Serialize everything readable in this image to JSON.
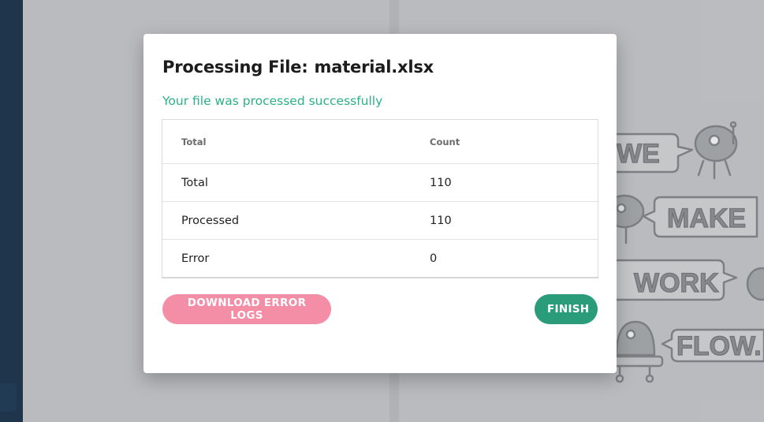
{
  "modal": {
    "title_prefix": "Processing File:",
    "file_name": "material.xlsx",
    "status_message": "Your file was processed successfully",
    "table": {
      "headers": [
        "Total",
        "Count"
      ],
      "rows": [
        {
          "label": "Total",
          "count": "110"
        },
        {
          "label": "Processed",
          "count": "110"
        },
        {
          "label": "Error",
          "count": "0"
        }
      ]
    },
    "buttons": {
      "download_label": "DOWNLOAD ERROR LOGS",
      "finish_label": "FINISH"
    }
  },
  "background": {
    "art_words": [
      "WE",
      "MAKE",
      "WORK",
      "FLOW."
    ]
  },
  "colors": {
    "success": "#2bb184",
    "download_button": "#f48ea7",
    "finish_button": "#2b9c7a",
    "sidebar": "#0b2640"
  }
}
